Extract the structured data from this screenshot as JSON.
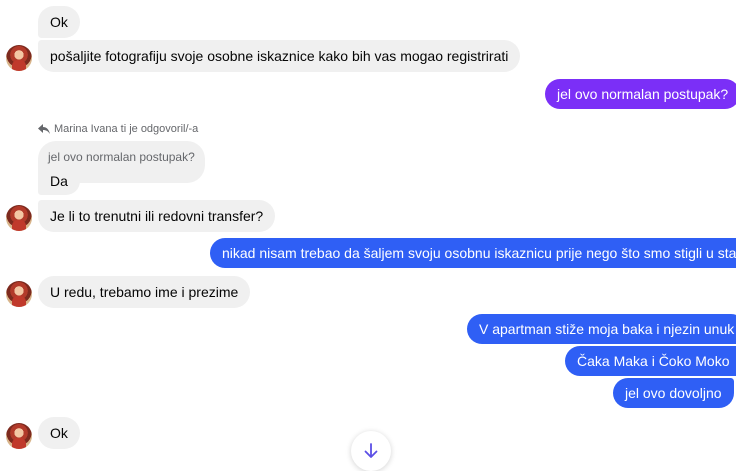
{
  "messages": {
    "m1": "Ok",
    "m2": "pošaljite fotografiju svoje osobne iskaznice kako bih vas mogao registrirati",
    "m3": "jel ovo normalan postupak?",
    "reply_label": "Marina Ivana ti je odgovoril/-a",
    "reply_quote": "jel ovo normalan postupak?",
    "m4": "Da",
    "m5": "Je li to trenutni ili redovni transfer?",
    "m6": "nikad nisam trebao da šaljem svoju osobnu iskaznicu prije nego što smo stigli u stan.",
    "m7": "U redu, trebamo ime i prezime",
    "m8": "V apartman stiže moja baka i njezin unuk",
    "m9": "Čaka Maka i Čoko Moko",
    "m10": "jel ovo dovoljno",
    "m11": "Ok"
  },
  "icons": {
    "reply": "reply-arrow-icon",
    "scroll": "arrow-down-icon"
  },
  "colors": {
    "incoming_bubble": "#f0f0f0",
    "outgoing_purple": "#7b2ff7",
    "outgoing_blue": "#2f5ff5",
    "scroll_arrow": "#5b4fe6"
  }
}
